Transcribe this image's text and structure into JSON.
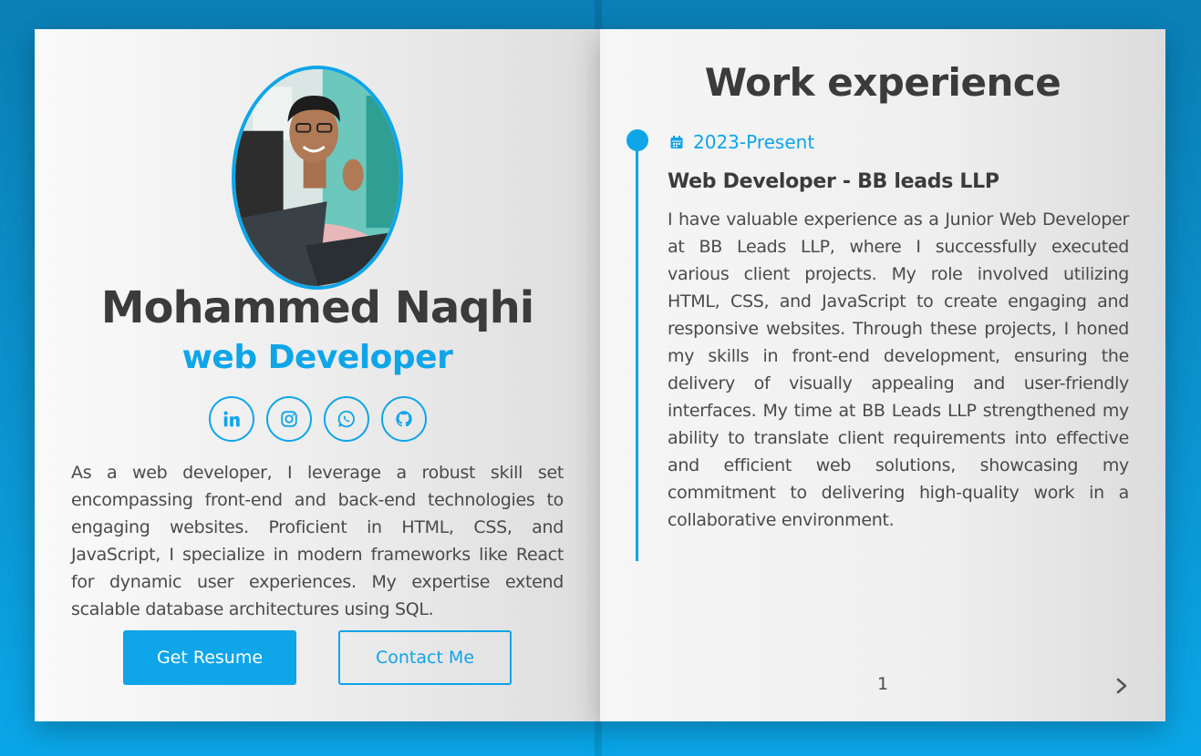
{
  "profile": {
    "name": "Mohammed Naqhi",
    "role": "web Developer",
    "bio": "As a web developer, I leverage a robust skill set encompassing front-end and back-end technologies to engaging websites. Proficient in HTML, CSS, and JavaScript, I specialize in modern frameworks like React for dynamic user experiences. My expertise extend scalable database architectures using SQL.",
    "socials": [
      {
        "icon": "linkedin-icon"
      },
      {
        "icon": "instagram-icon"
      },
      {
        "icon": "whatsapp-icon"
      },
      {
        "icon": "github-icon"
      }
    ],
    "buttons": {
      "resume_label": "Get Resume",
      "contact_label": "Contact Me"
    }
  },
  "experience": {
    "title": "Work experience",
    "entries": [
      {
        "date": "2023-Present",
        "job_title": "Web Developer - BB leads LLP",
        "description": "I have valuable experience as a Junior Web Developer at BB Leads LLP, where I successfully executed various client projects. My role involved utilizing HTML, CSS, and JavaScript to create engaging and responsive websites. Through these projects, I honed my skills in front-end development, ensuring the delivery of visually appealing and user-friendly interfaces. My time at BB Leads LLP strengthened my ability to translate client requirements into effective and efficient web solutions, showcasing my commitment to delivering high-quality work in a collaborative environment."
      }
    ],
    "page_number": "1"
  },
  "colors": {
    "accent": "#0ea5e9",
    "heading": "#3b3b3b",
    "text": "#4a4a4a",
    "background": "#0b93cf"
  }
}
